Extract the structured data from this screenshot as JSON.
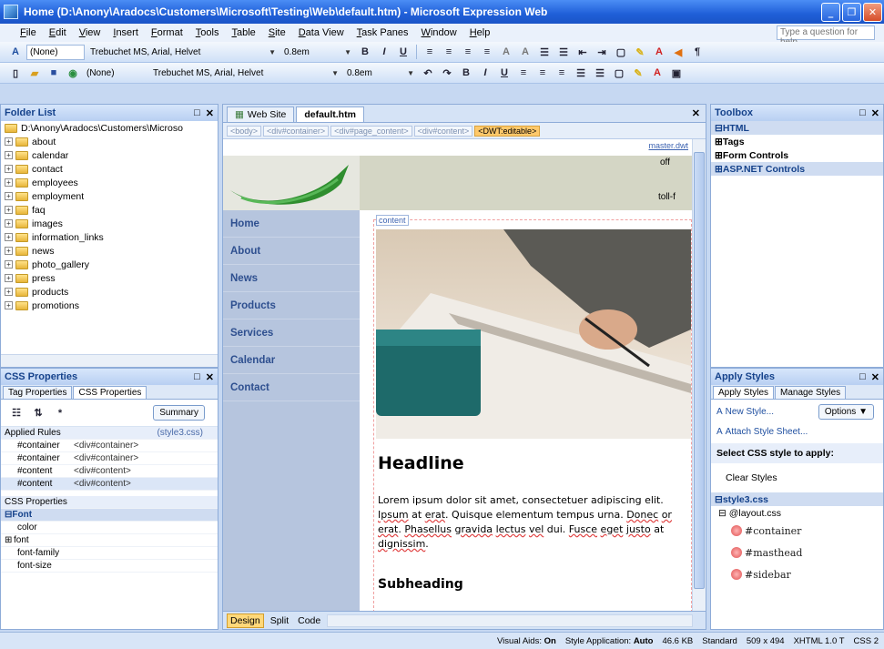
{
  "window": {
    "title": "Home (D:\\Anony\\Aradocs\\Customers\\Microsoft\\Testing\\Web\\default.htm) - Microsoft Expression Web"
  },
  "menu": [
    "File",
    "Edit",
    "View",
    "Insert",
    "Format",
    "Tools",
    "Table",
    "Site",
    "Data View",
    "Task Panes",
    "Window",
    "Help"
  ],
  "ask_placeholder": "Type a question for help",
  "toolbar1": {
    "style": "(None)",
    "font": "Trebuchet MS, Arial, Helvet",
    "size": "0.8em"
  },
  "toolbar2": {
    "style": "(None)",
    "font": "Trebuchet MS, Arial, Helvet",
    "size": "0.8em"
  },
  "folder_list": {
    "title": "Folder List",
    "root": "D:\\Anony\\Aradocs\\Customers\\Microso",
    "items": [
      "about",
      "calendar",
      "contact",
      "employees",
      "employment",
      "faq",
      "images",
      "information_links",
      "news",
      "photo_gallery",
      "press",
      "products",
      "promotions"
    ]
  },
  "css_properties": {
    "title": "CSS Properties",
    "tabs": [
      "Tag Properties",
      "CSS Properties"
    ],
    "summary": "Summary",
    "applied_rules_label": "Applied Rules",
    "applied_rules_file": "(style3.css)",
    "rules": [
      {
        "sel": "#container",
        "tag": "<div#container>"
      },
      {
        "sel": "#container",
        "tag": "<div#container>"
      },
      {
        "sel": "#content",
        "tag": "<div#content>"
      },
      {
        "sel": "#content",
        "tag": "<div#content>"
      }
    ],
    "props_label": "CSS Properties",
    "font_group": "Font",
    "props": [
      "color",
      "font",
      "font-family",
      "font-size"
    ]
  },
  "editor": {
    "tabs": [
      "Web Site",
      "default.htm"
    ],
    "quicktags": [
      "<body>",
      "<div#container>",
      "<div#page_content>",
      "<div#content>",
      "<DWT:editable>"
    ],
    "master_label": "master.dwt",
    "content_label": "content",
    "mast_text": [
      "off",
      "toll-f"
    ],
    "nav": [
      "Home",
      "About",
      "News",
      "Products",
      "Services",
      "Calendar",
      "Contact"
    ],
    "headline": "Headline",
    "body_parts": [
      "Lorem ipsum dolor sit amet, consectetuer adipiscing elit. ",
      "Ipsum",
      " at ",
      "erat",
      ". Quisque elementum tempus urna. ",
      "Donec",
      " ",
      "or",
      " ",
      "erat",
      ". ",
      "Phasellus",
      " ",
      "gravida",
      " ",
      "lectus",
      " ",
      "vel",
      " dui. ",
      "Fusce",
      " ",
      "eget",
      " ",
      "justo",
      " at ",
      "dignissim",
      "."
    ],
    "subheading": "Subheading",
    "view_tabs": [
      "Design",
      "Split",
      "Code"
    ]
  },
  "toolbox": {
    "title": "Toolbox",
    "sections": [
      "HTML",
      "Tags",
      "Form Controls",
      "ASP.NET Controls"
    ]
  },
  "apply_styles": {
    "title": "Apply Styles",
    "tabs": [
      "Apply Styles",
      "Manage Styles"
    ],
    "new_style": "New Style...",
    "options": "Options",
    "attach": "Attach Style Sheet...",
    "select_label": "Select CSS style to apply:",
    "clear": "Clear Styles",
    "sheets": [
      "style3.css",
      "layout.css"
    ],
    "styles": [
      "#container",
      "#masthead",
      "#sidebar"
    ]
  },
  "status": {
    "visual_aids_label": "Visual Aids:",
    "visual_aids": "On",
    "style_app_label": "Style Application:",
    "style_app": "Auto",
    "size": "46.6 KB",
    "mode": "Standard",
    "dims": "509 x 494",
    "doctype": "XHTML 1.0 T",
    "css": "CSS 2"
  }
}
